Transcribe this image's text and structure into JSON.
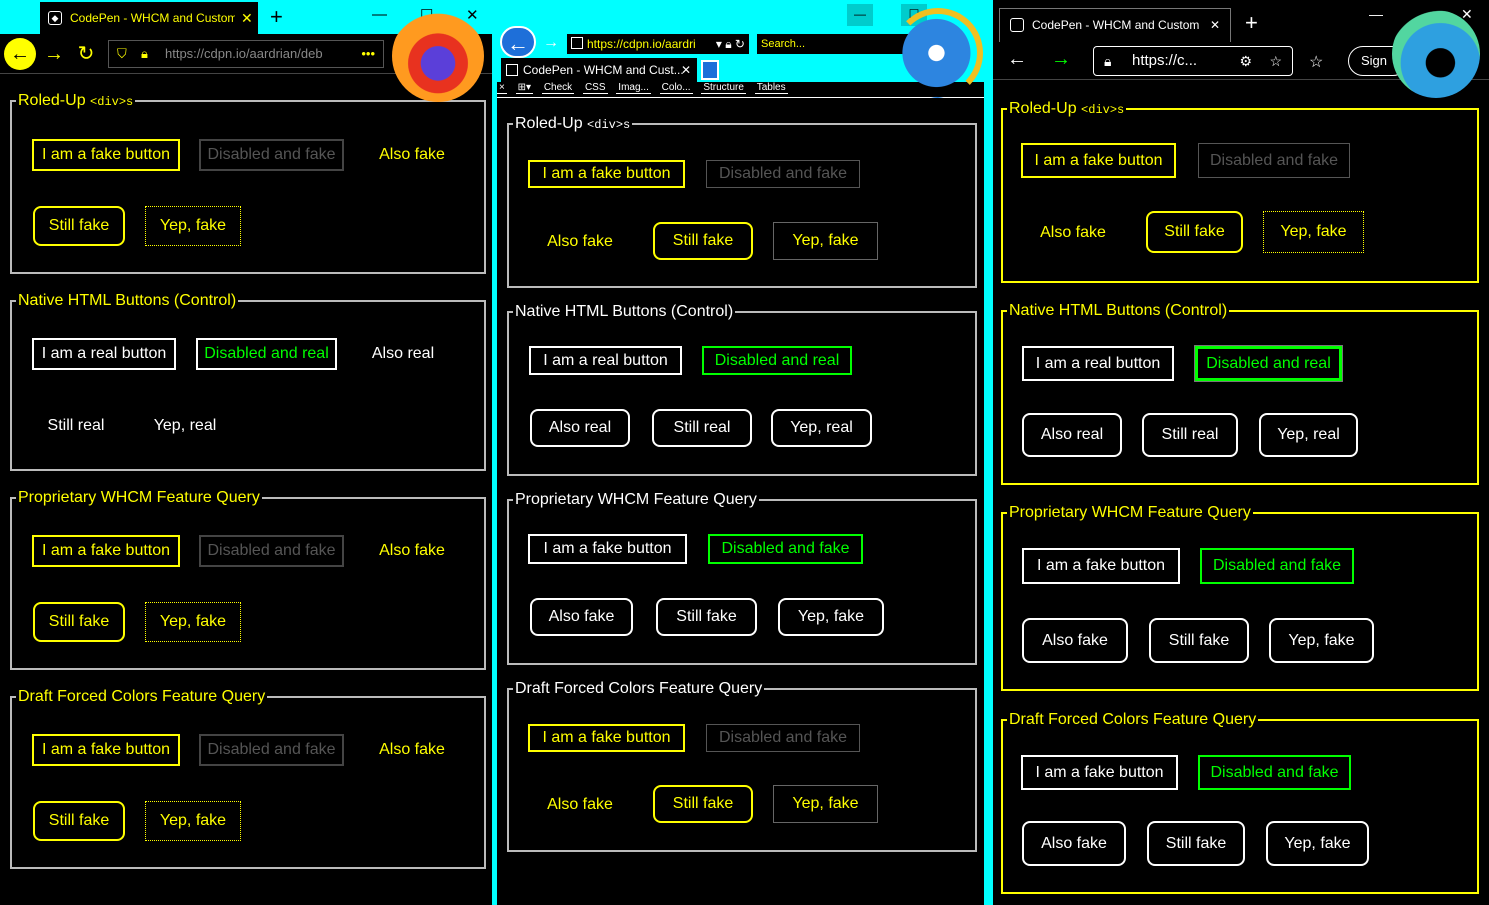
{
  "colors": {
    "window_accent": "#00ffff",
    "fake_text": "#ffff00",
    "disabled_real": "#00ff00",
    "real_text": "#ffffff",
    "background": "#000000"
  },
  "firefox": {
    "tab_title": "CodePen - WHCM and Custom",
    "url": "https://cdpn.io/aardrian/deb",
    "icons": [
      "back-icon",
      "forward-icon",
      "reload-icon",
      "shield-icon",
      "lock-icon",
      "more-icon",
      "firefox-logo"
    ],
    "sections": [
      {
        "legend": "Roled-Up",
        "legend_code": "<div>s",
        "buttons": [
          "I am a fake button",
          "Disabled and fake",
          "Also fake",
          "Still fake",
          "Yep, fake"
        ]
      },
      {
        "legend": "Native HTML Buttons (Control)",
        "buttons": [
          "I am a real button",
          "Disabled and real",
          "Also real",
          "Still real",
          "Yep, real"
        ]
      },
      {
        "legend": "Proprietary WHCM Feature Query",
        "buttons": [
          "I am a fake button",
          "Disabled and fake",
          "Also fake",
          "Still fake",
          "Yep, fake"
        ]
      },
      {
        "legend": "Draft Forced Colors Feature Query",
        "buttons": [
          "I am a fake button",
          "Disabled and fake",
          "Also fake",
          "Still fake",
          "Yep, fake"
        ]
      }
    ]
  },
  "ie": {
    "url": "https://cdpn.io/aardri",
    "search_placeholder": "Search...",
    "tab_title": "CodePen - WHCM and Cust...",
    "command_bar": [
      "Check",
      "CSS",
      "Imag...",
      "Colo...",
      "Structure",
      "Tables"
    ],
    "sections": [
      {
        "legend": "Roled-Up",
        "legend_code": "<div>s",
        "buttons": [
          "I am a fake button",
          "Disabled and fake",
          "Also fake",
          "Still fake",
          "Yep, fake"
        ]
      },
      {
        "legend": "Native HTML Buttons (Control)",
        "buttons": [
          "I am a real button",
          "Disabled and real",
          "Also real",
          "Still real",
          "Yep, real"
        ]
      },
      {
        "legend": "Proprietary WHCM Feature Query",
        "buttons": [
          "I am a fake button",
          "Disabled and fake",
          "Also fake",
          "Still fake",
          "Yep, fake"
        ]
      },
      {
        "legend": "Draft Forced Colors Feature Query",
        "buttons": [
          "I am a fake button",
          "Disabled and fake",
          "Also fake",
          "Still fake",
          "Yep, fake"
        ]
      }
    ]
  },
  "edge": {
    "tab_title": "CodePen - WHCM and Custom",
    "url": "https://c...",
    "sign_in": "Sign",
    "sections": [
      {
        "legend": "Roled-Up",
        "legend_code": "<div>s",
        "buttons": [
          "I am a fake button",
          "Disabled and fake",
          "Also fake",
          "Still fake",
          "Yep, fake"
        ]
      },
      {
        "legend": "Native HTML Buttons (Control)",
        "buttons": [
          "I am a real button",
          "Disabled and real",
          "Also real",
          "Still real",
          "Yep, real"
        ]
      },
      {
        "legend": "Proprietary WHCM Feature Query",
        "buttons": [
          "I am a fake button",
          "Disabled and fake",
          "Also fake",
          "Still fake",
          "Yep, fake"
        ]
      },
      {
        "legend": "Draft Forced Colors Feature Query",
        "buttons": [
          "I am a fake button",
          "Disabled and fake",
          "Also fake",
          "Still fake",
          "Yep, fake"
        ]
      }
    ]
  }
}
